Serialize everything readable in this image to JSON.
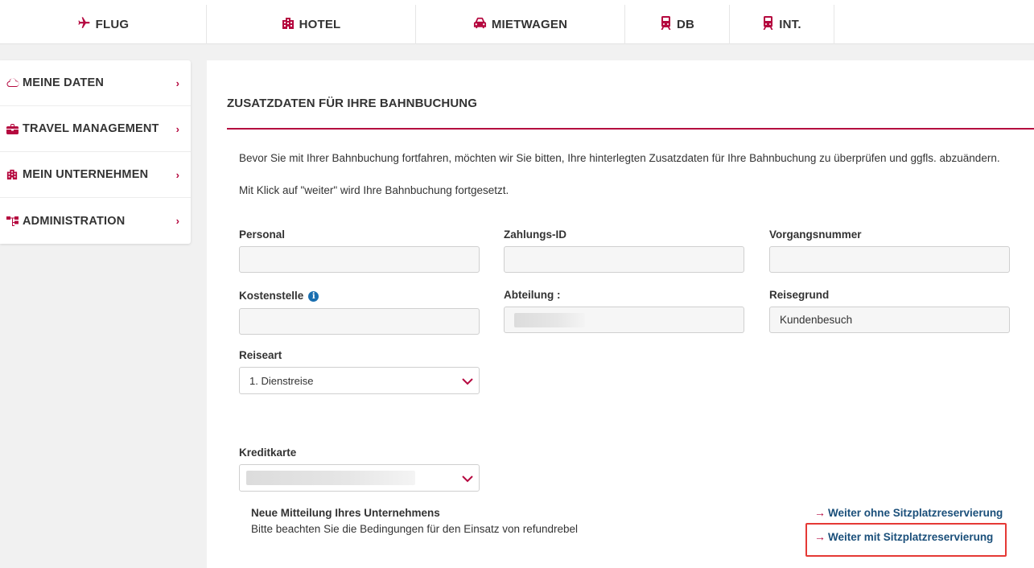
{
  "topnav": {
    "tabs": [
      {
        "label": "FLUG",
        "icon": "plane-icon"
      },
      {
        "label": "HOTEL",
        "icon": "building-icon"
      },
      {
        "label": "MIETWAGEN",
        "icon": "car-icon"
      },
      {
        "label": "DB",
        "icon": "train-icon"
      },
      {
        "label": "INT.",
        "icon": "train-icon"
      }
    ]
  },
  "sidebar": {
    "items": [
      {
        "label": "MEINE DATEN",
        "icon": "cloud-icon"
      },
      {
        "label": "TRAVEL MANAGEMENT",
        "icon": "briefcase-icon"
      },
      {
        "label": "MEIN UNTERNEHMEN",
        "icon": "building-icon"
      },
      {
        "label": "ADMINISTRATION",
        "icon": "org-chart-icon"
      }
    ]
  },
  "main": {
    "title": "ZUSATZDATEN FÜR IHRE BAHNBUCHUNG",
    "intro1": "Bevor Sie mit Ihrer Bahnbuchung fortfahren, möchten wir Sie bitten, Ihre hinterlegten Zusatzdaten für Ihre Bahnbuchung zu überprüfen und ggfls. abzuändern.",
    "intro2": "Mit Klick auf \"weiter\" wird Ihre Bahnbuchung fortgesetzt."
  },
  "form": {
    "personal": {
      "label": "Personal",
      "value": ""
    },
    "zahlungs_id": {
      "label": "Zahlungs-ID",
      "value": ""
    },
    "vorgangsnummer": {
      "label": "Vorgangsnummer",
      "value": ""
    },
    "kostenstelle": {
      "label": "Kostenstelle",
      "value": ""
    },
    "abteilung": {
      "label": "Abteilung :",
      "value": ""
    },
    "reisegrund": {
      "label": "Reisegrund",
      "value": "Kundenbesuch"
    },
    "reiseart": {
      "label": "Reiseart",
      "value": "1. Dienstreise"
    },
    "kreditkarte": {
      "label": "Kreditkarte",
      "value": ""
    }
  },
  "message": {
    "title": "Neue Mitteilung Ihres Unternehmens",
    "body": "Bitte beachten Sie die Bedingungen für den Einsatz von refundrebel"
  },
  "actions": {
    "without_seat": "Weiter ohne Sitzplatzreservierung",
    "with_seat": "Weiter mit Sitzplatzreservierung"
  },
  "colors": {
    "accent": "#b5083f",
    "link": "#1a4f7a",
    "highlight": "#e53935",
    "info": "#1a6fb0"
  }
}
